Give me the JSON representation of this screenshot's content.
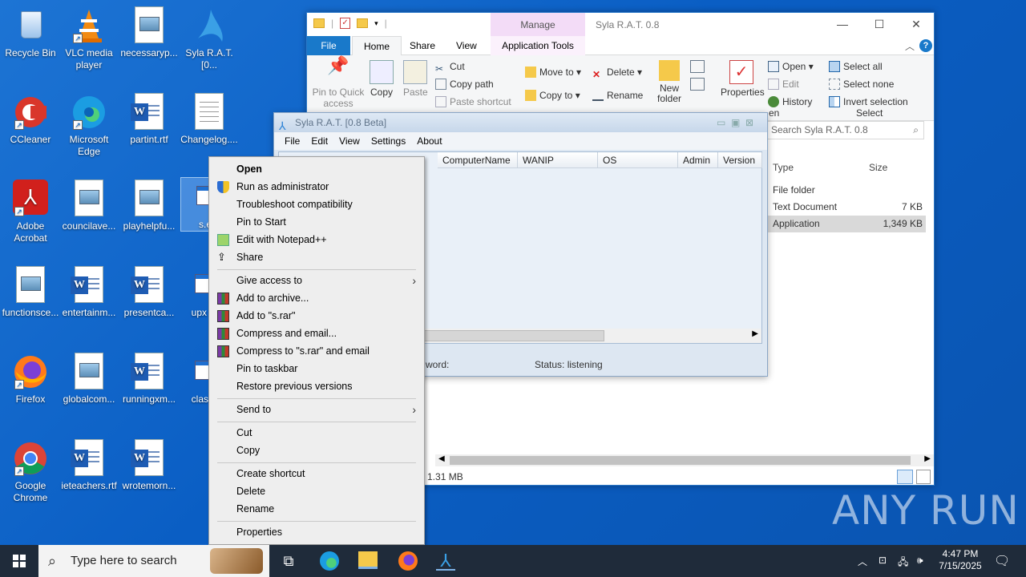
{
  "desktop": {
    "icons": [
      {
        "label": "Recycle Bin"
      },
      {
        "label": "VLC media player"
      },
      {
        "label": "necessaryp..."
      },
      {
        "label": "Syla R.A.T.[0..."
      },
      {
        "label": "CCleaner"
      },
      {
        "label": "Microsoft Edge"
      },
      {
        "label": "partint.rtf"
      },
      {
        "label": "Changelog...."
      },
      {
        "label": "Adobe Acrobat"
      },
      {
        "label": "councilave..."
      },
      {
        "label": "playhelpfu..."
      },
      {
        "label": "s.e"
      },
      {
        "label": "functionsce..."
      },
      {
        "label": "entertainm..."
      },
      {
        "label": "presentca..."
      },
      {
        "label": "upx"
      },
      {
        "label": "Firefox"
      },
      {
        "label": "globalcom..."
      },
      {
        "label": "runningxm..."
      },
      {
        "label": "clas"
      },
      {
        "label": "Google Chrome"
      },
      {
        "label": "ieteachers.rtf"
      },
      {
        "label": "wrotemorn..."
      }
    ]
  },
  "explorer": {
    "title": "Syla R.A.T. 0.8",
    "manage_label": "Manage",
    "tabs": {
      "file": "File",
      "home": "Home",
      "share": "Share",
      "view": "View",
      "app_tools": "Application Tools"
    },
    "ribbon": {
      "pin": "Pin to Quick access",
      "copy": "Copy",
      "paste": "Paste",
      "cut": "Cut",
      "copy_path": "Copy path",
      "paste_shortcut": "Paste shortcut",
      "move_to": "Move to",
      "copy_to": "Copy to",
      "delete": "Delete",
      "rename": "Rename",
      "new_folder": "New folder",
      "properties": "Properties",
      "open": "Open",
      "edit": "Edit",
      "history": "History",
      "open_group": "en",
      "select_all": "Select all",
      "select_none": "Select none",
      "invert_selection": "Invert selection",
      "select_group": "Select"
    },
    "search_placeholder": "Search Syla R.A.T. 0.8",
    "columns": {
      "type": "Type",
      "size": "Size"
    },
    "rows": [
      {
        "type": "File folder",
        "size": ""
      },
      {
        "type": "Text Document",
        "size": "7 KB"
      },
      {
        "type": "Application",
        "size": "1,349 KB"
      }
    ],
    "status": "d  1.31 MB"
  },
  "rat": {
    "title": "Syla R.A.T. [0.8 Beta]",
    "menu": [
      "File",
      "Edit",
      "View",
      "Settings",
      "About"
    ],
    "columns": [
      "ComputerName",
      "WANIP",
      "OS",
      "Admin",
      "Version"
    ],
    "status_left": "word:",
    "status_right": "Status: listening"
  },
  "context_menu": {
    "items": [
      "Open",
      "Run as administrator",
      "Troubleshoot compatibility",
      "Pin to Start",
      "Edit with Notepad++",
      "Share",
      "Give access to",
      "Add to archive...",
      "Add to \"s.rar\"",
      "Compress and email...",
      "Compress to \"s.rar\" and email",
      "Pin to taskbar",
      "Restore previous versions",
      "Send to",
      "Cut",
      "Copy",
      "Create shortcut",
      "Delete",
      "Rename",
      "Properties"
    ]
  },
  "taskbar": {
    "search_placeholder": "Type here to search",
    "time": "4:47 PM",
    "date": "7/15/2025"
  },
  "watermark": "ANY RUN"
}
